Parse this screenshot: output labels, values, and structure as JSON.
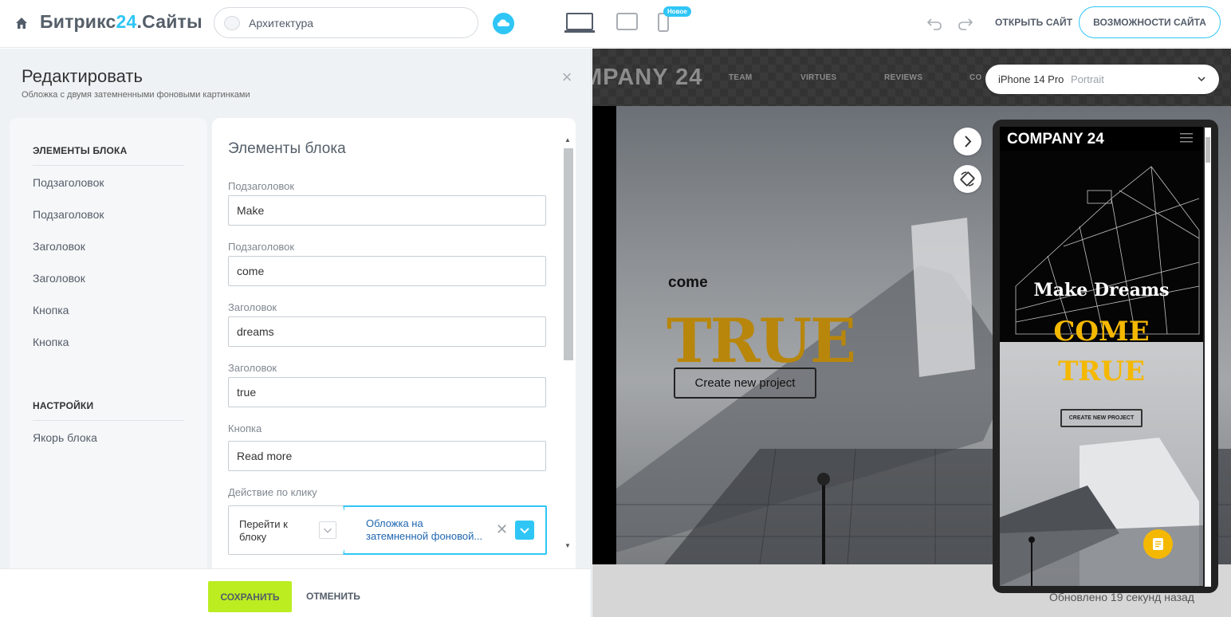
{
  "topbar": {
    "brand_part1": "Битрикс",
    "brand_part2": "24",
    "brand_part3": ".Сайты",
    "site_name": "Архитектура",
    "new_badge": "Новое",
    "open_site": "ОТКРЫТЬ САЙТ",
    "features": "ВОЗМОЖНОСТИ САЙТА",
    "accent_color": "#2fc6f6"
  },
  "editor": {
    "title": "Редактировать",
    "subtitle": "Обложка с двумя затемненными фоновыми картинками",
    "nav": {
      "section1": "ЭЛЕМЕНТЫ БЛОКА",
      "items1": [
        "Подзаголовок",
        "Подзаголовок",
        "Заголовок",
        "Заголовок",
        "Кнопка",
        "Кнопка"
      ],
      "section2": "НАСТРОЙКИ",
      "items2": [
        "Якорь блока"
      ]
    },
    "form": {
      "title": "Элементы блока",
      "fields": [
        {
          "label": "Подзаголовок",
          "value": "Make"
        },
        {
          "label": "Подзаголовок",
          "value": "come"
        },
        {
          "label": "Заголовок",
          "value": "dreams"
        },
        {
          "label": "Заголовок",
          "value": "true"
        },
        {
          "label": "Кнопка",
          "value": "Read more"
        }
      ],
      "action_label": "Действие по клику",
      "action_type": "Перейти к блоку",
      "action_target_line1": "Обложка на",
      "action_target_line2": "затемненной фоновой..."
    },
    "save": "СОХРАНИТЬ",
    "cancel": "ОТМЕНИТЬ",
    "save_color": "#bbed21"
  },
  "preview": {
    "logo": "MPANY 24",
    "nav": [
      "TEAM",
      "VIRTUES",
      "REVIEWS",
      "CO"
    ],
    "come": "come",
    "true_text": "TRUE",
    "create_btn": "Create new project",
    "updated": "Обновлено 19 секунд назад",
    "device_name": "iPhone 14 Pro",
    "device_orientation": "Portrait",
    "phone": {
      "logo": "COMPANY 24",
      "make": "Make Dreams",
      "come": "COME",
      "true_text": "TRUE",
      "create_btn": "CREATE NEW PROJECT"
    }
  }
}
